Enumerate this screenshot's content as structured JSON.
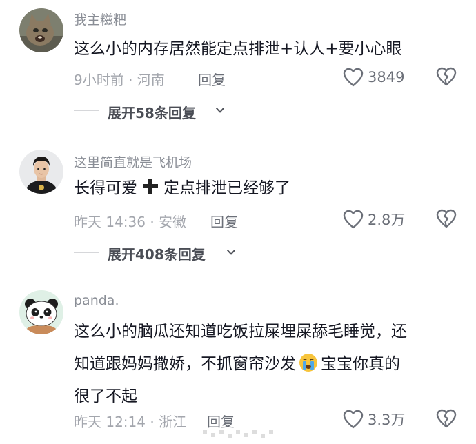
{
  "comments": [
    {
      "username": "我主糍粑",
      "text": "这么小的内存居然能定点排泄+认人+要小心眼",
      "time_location": "9小时前 · 河南",
      "reply_label": "回复",
      "likes": "3849",
      "expand_label": "展开58条回复",
      "avatar": "cat-photo"
    },
    {
      "username": "这里简直就是飞机场",
      "text_part1": "长得可爱",
      "text_part2": "定点排泄已经够了",
      "time_location": "昨天 14:36 · 安徽",
      "reply_label": "回复",
      "likes": "2.8万",
      "expand_label": "展开408条回复",
      "avatar": "man-photo"
    },
    {
      "username": "panda.",
      "text_line1": "这么小的脑瓜还知道吃饭拉屎埋屎舔毛睡觉，还",
      "text_line2a": "知道跟妈妈撒娇，不抓窗帘沙发",
      "text_line2b": "宝宝你真的",
      "text_line3": "很了不起",
      "time_location": "昨天 12:14 · 浙江",
      "reply_label": "回复",
      "likes": "3.3万",
      "avatar": "panda-cartoon"
    }
  ],
  "colors": {
    "text": "#161823",
    "meta": "#a3a6ad",
    "icon": "#6b6f78"
  },
  "icons": [
    "heart-outline-icon",
    "broken-heart-icon",
    "chevron-down-icon",
    "plus-icon",
    "crying-face-icon"
  ]
}
